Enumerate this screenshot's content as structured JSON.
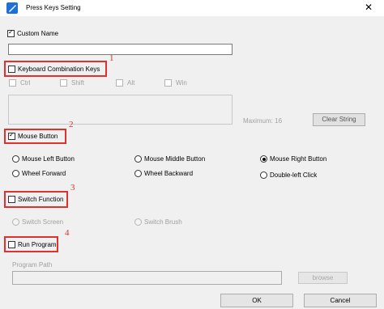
{
  "window": {
    "title": "Press Keys Setting",
    "close": "✕"
  },
  "custom_name": {
    "label": "Custom Name",
    "checked": true,
    "value": ""
  },
  "keyboard": {
    "label": "Keyboard Combination Keys",
    "checked": false,
    "annotation": "1",
    "modifiers": [
      "Ctrl",
      "Shift",
      "Alt",
      "Win"
    ],
    "maximum": "Maximum: 16",
    "clear_button": "Clear String"
  },
  "mouse": {
    "label": "Mouse Button",
    "checked": true,
    "annotation": "2",
    "options": [
      "Mouse Left Button",
      "Mouse Middle Button",
      "Mouse Right Button",
      "Wheel Forward",
      "Wheel Backward",
      "Double-left Click"
    ],
    "selected": "Mouse Right Button"
  },
  "switch": {
    "label": "Switch Function",
    "checked": false,
    "annotation": "3",
    "options": [
      "Switch Screen",
      "Switch Brush"
    ]
  },
  "program": {
    "label": "Run Program",
    "checked": false,
    "annotation": "4",
    "path_label": "Program Path",
    "browse_button": "browse"
  },
  "buttons": {
    "ok": "OK",
    "cancel": "Cancel"
  },
  "colors": {
    "annotation": "#e03030",
    "accent": "#1e6fd9"
  }
}
